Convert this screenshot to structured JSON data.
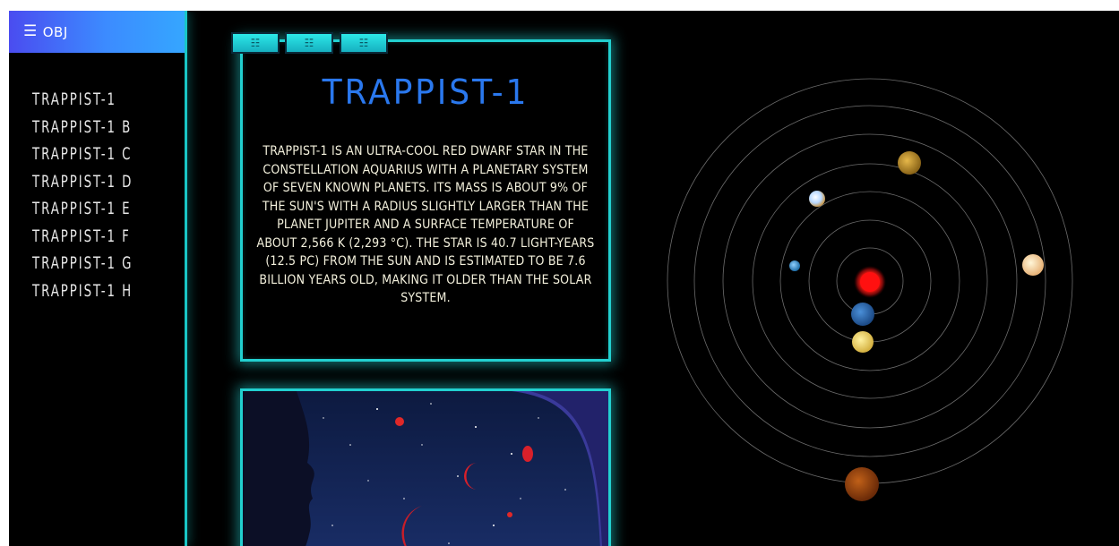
{
  "menu": {
    "icon": "menu-icon",
    "icon_glyph": "☰",
    "label": "OBJ"
  },
  "nav": {
    "items": [
      "TRAPPIST-1",
      "TRAPPIST-1 B",
      "TRAPPIST-1 C",
      "TRAPPIST-1 D",
      "TRAPPIST-1 E",
      "TRAPPIST-1 F",
      "TRAPPIST-1 G",
      "TRAPPIST-1 H"
    ]
  },
  "tabs": [
    {
      "icon": "grid-icon",
      "glyph": "☷"
    },
    {
      "icon": "grid-icon",
      "glyph": "☷"
    },
    {
      "icon": "grid-icon",
      "glyph": "☷"
    }
  ],
  "info": {
    "title": "TRAPPIST-1",
    "description": "TRAPPIST-1 is an ultra-cool red dwarf star in the constellation Aquarius with a planetary system of seven known planets. Its mass is about 9% of the Sun's with a radius slightly larger than the planet Jupiter and a surface temperature of about 2,566 K (2,293 °C). The star is 40.7 light-years (12.5 pc) from the Sun and is estimated to be 7.6 billion years old, making it older than the Solar System."
  },
  "colors": {
    "accent": "#22d0d0",
    "title": "#2a78ee",
    "menu_gradient_start": "#4a4cf0",
    "menu_gradient_end": "#35a6ff",
    "star": "#ff1a1a"
  },
  "orbit_system": {
    "star": "TRAPPIST-1",
    "planets": [
      "b",
      "c",
      "d",
      "e",
      "f",
      "g",
      "h"
    ]
  }
}
